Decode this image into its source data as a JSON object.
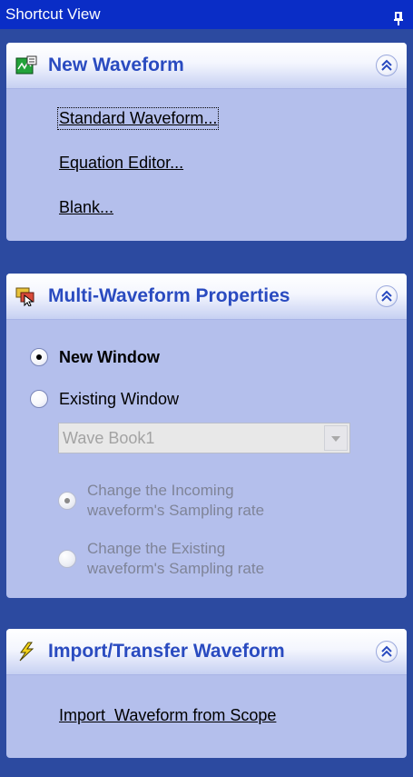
{
  "titlebar": {
    "title": "Shortcut View",
    "pin_icon": "pin-icon"
  },
  "new_waveform": {
    "title": "New Waveform",
    "icon": "new-waveform-icon",
    "links": [
      "Standard Waveform...",
      "Equation Editor...",
      "Blank..."
    ]
  },
  "multi_waveform": {
    "title": "Multi-Waveform Properties",
    "icon": "multi-waveform-icon",
    "new_window_label": "New Window",
    "existing_window_label": "Existing Window",
    "selected_option": "New Window",
    "window_select_value": "Wave Book1",
    "change_incoming_label_1": "Change the Incoming",
    "change_incoming_label_2": "waveform's Sampling rate",
    "change_existing_label_1": "Change the Existing",
    "change_existing_label_2": "waveform's Sampling rate"
  },
  "import_transfer": {
    "title": "Import/Transfer Waveform",
    "icon": "lightning-icon",
    "link": "Import  Waveform from Scope"
  },
  "colors": {
    "titlebar": "#0a2dc6",
    "background": "#2c4aa0",
    "panel_body": "#b4bfec",
    "header_text": "#2a4bc0"
  }
}
